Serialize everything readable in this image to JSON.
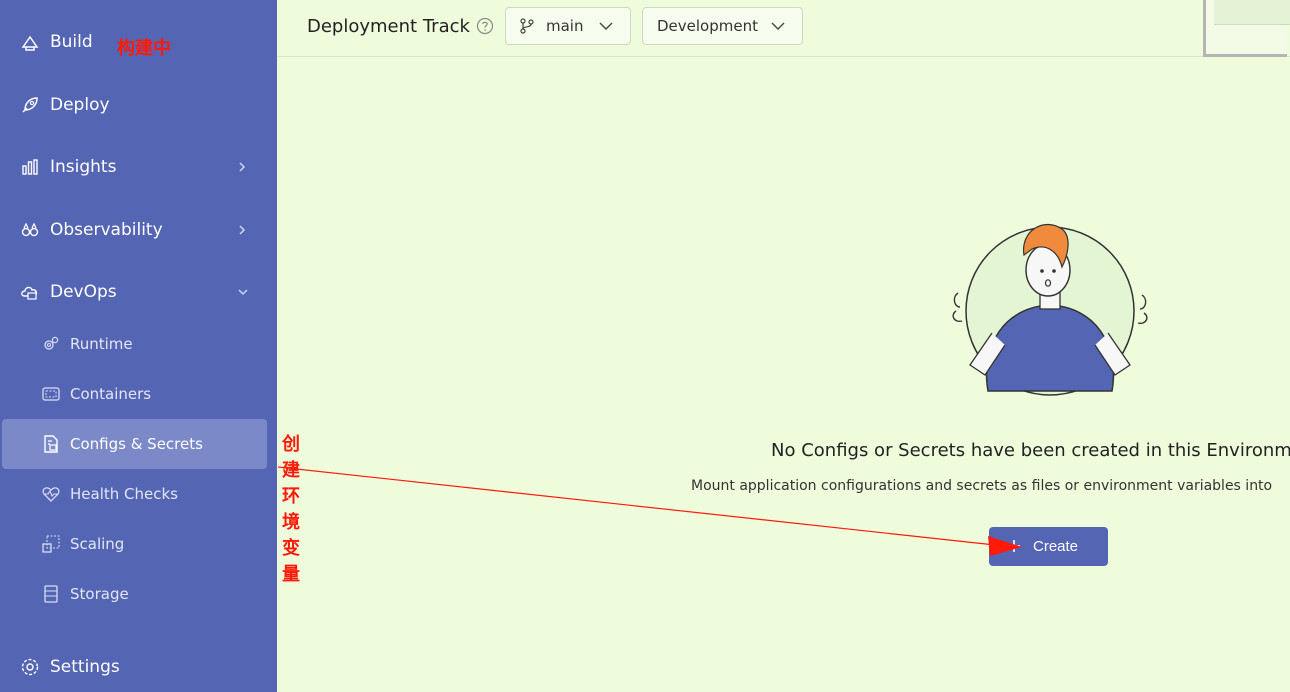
{
  "sidebar": {
    "items": [
      {
        "label": "Build",
        "icon": "build-icon"
      },
      {
        "label": "Deploy",
        "icon": "rocket-icon"
      },
      {
        "label": "Insights",
        "icon": "bar-chart-icon"
      },
      {
        "label": "Observability",
        "icon": "binoculars-icon"
      },
      {
        "label": "DevOps",
        "icon": "devops-cloud-icon"
      },
      {
        "label": "Settings",
        "icon": "gear-icon"
      }
    ],
    "devops_children": [
      {
        "label": "Runtime",
        "icon": "cogs-icon"
      },
      {
        "label": "Containers",
        "icon": "container-icon"
      },
      {
        "label": "Configs & Secrets",
        "icon": "config-file-icon",
        "active": true
      },
      {
        "label": "Health Checks",
        "icon": "heart-pulse-icon"
      },
      {
        "label": "Scaling",
        "icon": "scaling-icon"
      },
      {
        "label": "Storage",
        "icon": "storage-icon"
      }
    ],
    "accent": "#5465b4",
    "active_bg": "#7b89c8"
  },
  "annotations": {
    "build": "构建中",
    "configs": "创建环境变量",
    "color": "#ff1a0a"
  },
  "header": {
    "title": "Deployment Track",
    "branch": "main",
    "environment": "Development"
  },
  "empty_state": {
    "title": "No Configs or Secrets have been created in this Environm",
    "description": "Mount application configurations and secrets as files or environment variables into",
    "create_label": "Create"
  },
  "colors": {
    "background": "#eefcdc",
    "primary": "#5465b4"
  }
}
